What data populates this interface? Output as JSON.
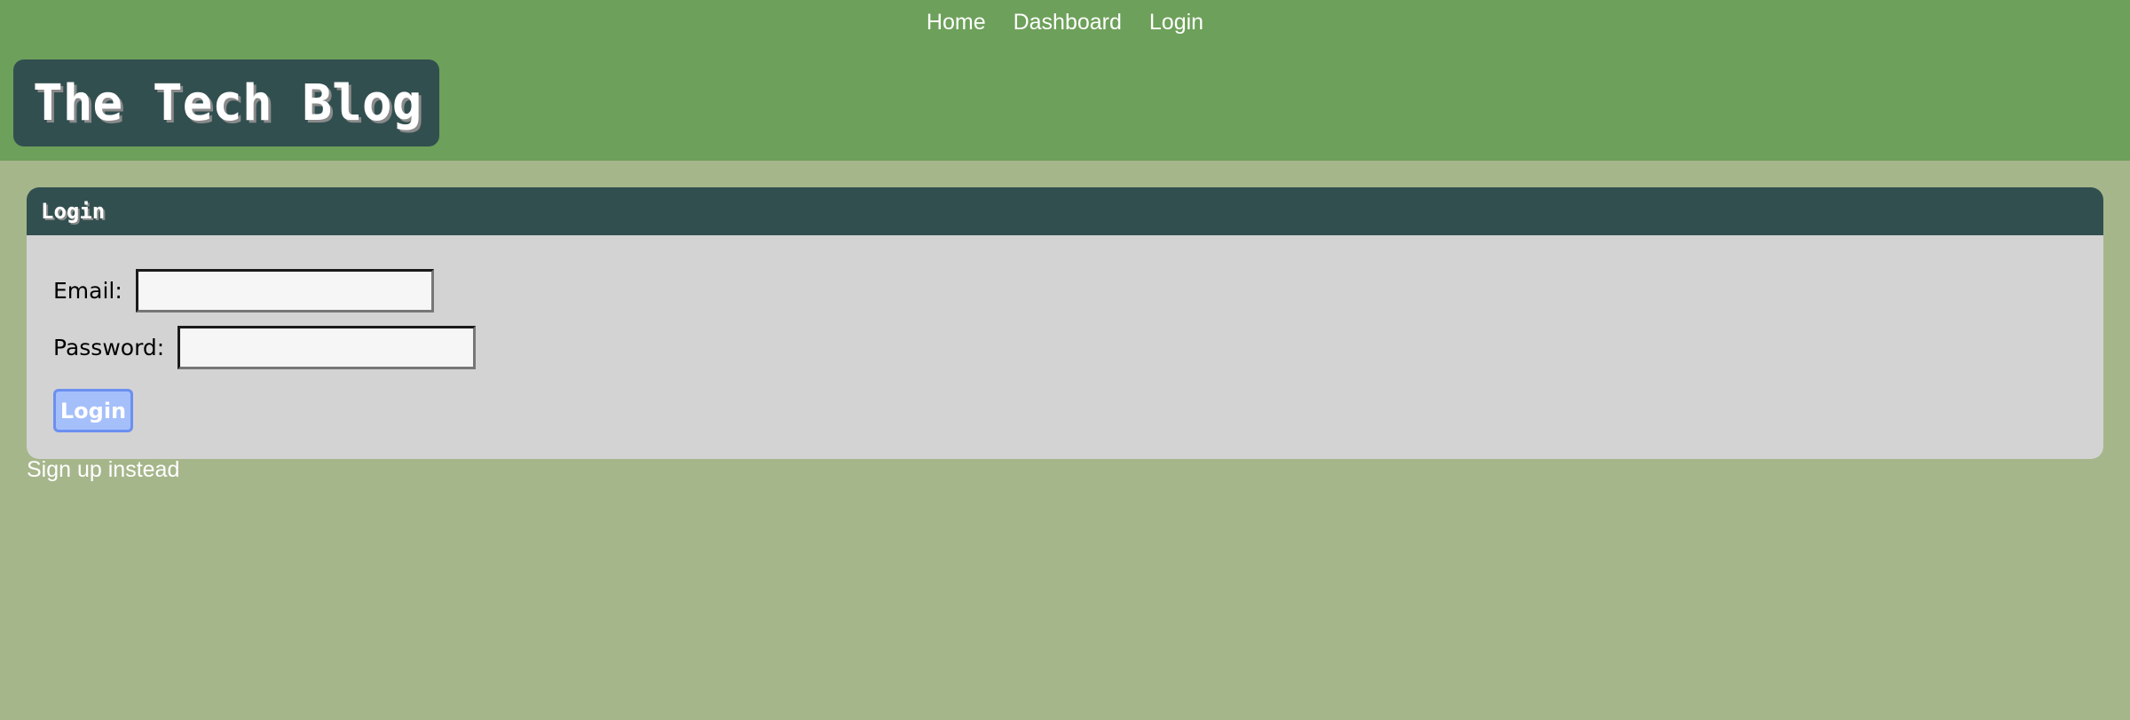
{
  "nav": {
    "items": [
      {
        "label": "Home"
      },
      {
        "label": "Dashboard"
      },
      {
        "label": "Login"
      }
    ]
  },
  "site": {
    "title": "The Tech Blog"
  },
  "login_card": {
    "title": "Login",
    "email": {
      "label": "Email:",
      "value": "",
      "placeholder": ""
    },
    "password": {
      "label": "Password:",
      "value": "",
      "placeholder": ""
    },
    "submit_label": "Login"
  },
  "signup_link": "Sign up instead",
  "colors": {
    "header_bg": "#6da05a",
    "page_bg": "#a6b68b",
    "dark_panel": "#324f50",
    "card_bg": "#d3d3d3",
    "button_bg": "#a5bffa",
    "button_border": "#6c8ff0"
  }
}
